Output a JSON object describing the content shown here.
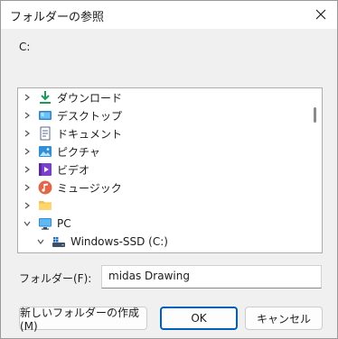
{
  "window": {
    "title": "フォルダーの参照",
    "close_icon": "close-icon"
  },
  "prompt": "C:",
  "tree": {
    "items": [
      {
        "label": "ダウンロード",
        "icon": "download-icon",
        "expander": "collapsed"
      },
      {
        "label": "デスクトップ",
        "icon": "desktop-icon",
        "expander": "collapsed"
      },
      {
        "label": "ドキュメント",
        "icon": "documents-icon",
        "expander": "collapsed"
      },
      {
        "label": "ピクチャ",
        "icon": "pictures-icon",
        "expander": "collapsed"
      },
      {
        "label": "ビデオ",
        "icon": "videos-icon",
        "expander": "collapsed"
      },
      {
        "label": "ミュージック",
        "icon": "music-icon",
        "expander": "collapsed"
      },
      {
        "label": "",
        "icon": "folder-icon",
        "expander": "collapsed"
      },
      {
        "label": "PC",
        "icon": "pc-icon",
        "expander": "expanded"
      },
      {
        "label": "Windows-SSD (C:)",
        "icon": "drive-icon",
        "expander": "expanded"
      }
    ]
  },
  "folder_field": {
    "label": "フォルダー(F):",
    "value": "midas Drawing"
  },
  "buttons": {
    "new_folder": "新しいフォルダーの作成(M)",
    "ok": "OK",
    "cancel": "キャンセル"
  },
  "colors": {
    "accent": "#005fb8",
    "background": "#f0f0f0"
  }
}
